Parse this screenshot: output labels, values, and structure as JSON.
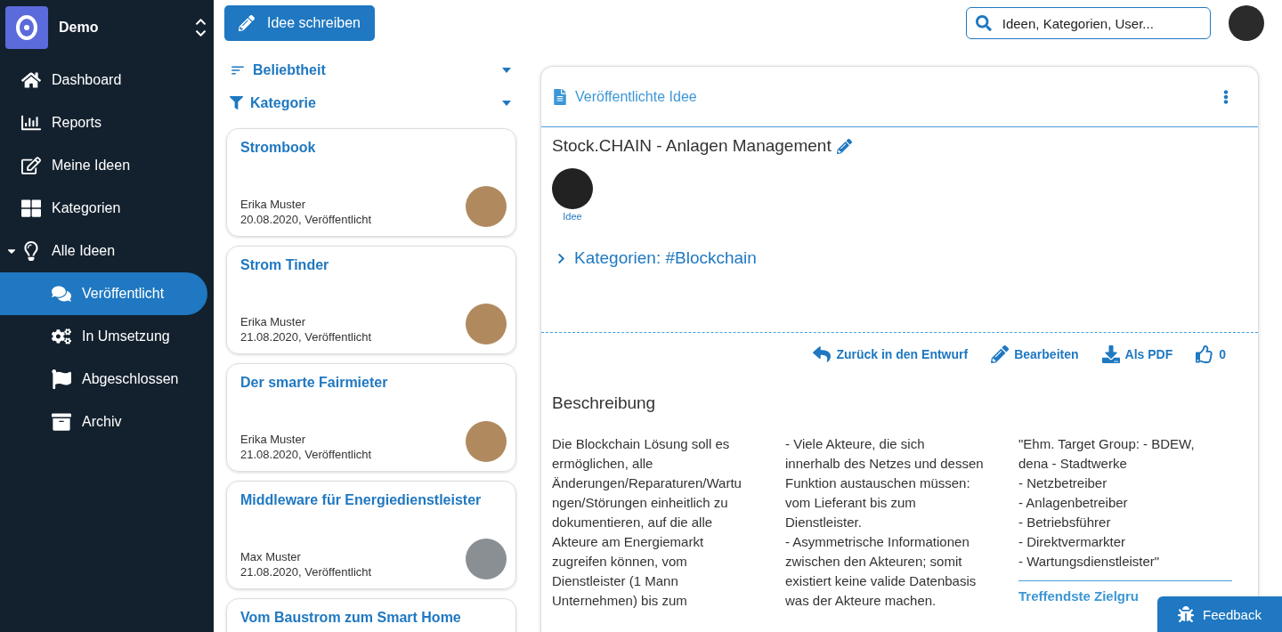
{
  "workspace": {
    "name": "Demo"
  },
  "nav": [
    {
      "label": "Dashboard",
      "selected": false
    },
    {
      "label": "Reports",
      "selected": false
    },
    {
      "label": "Meine Ideen",
      "selected": false
    },
    {
      "label": "Kategorien",
      "selected": false
    },
    {
      "label": "Alle Ideen",
      "selected": false,
      "expanded": true,
      "children": [
        {
          "label": "Veröffentlicht",
          "selected": true
        },
        {
          "label": "In Umsetzung",
          "selected": false
        },
        {
          "label": "Abgeschlossen",
          "selected": false
        },
        {
          "label": "Archiv",
          "selected": false
        }
      ]
    }
  ],
  "toolbar": {
    "write_button": "Idee schreiben",
    "search": {
      "placeholder": "Ideen, Kategorien, User..."
    }
  },
  "filters": [
    {
      "label": "Beliebtheit",
      "kind": "sort"
    },
    {
      "label": "Kategorie",
      "kind": "filter"
    }
  ],
  "ideas": [
    {
      "title": "Strombook",
      "author": "Erika Muster",
      "meta": "20.08.2020, Veröffentlicht"
    },
    {
      "title": "Strom Tinder",
      "author": "Erika Muster",
      "meta": "21.08.2020, Veröffentlicht"
    },
    {
      "title": "Der smarte Fairmieter",
      "author": "Erika Muster",
      "meta": "21.08.2020, Veröffentlicht"
    },
    {
      "title": "Middleware für Energiedienstleister",
      "author": "Max Muster",
      "meta": "21.08.2020, Veröffentlicht"
    },
    {
      "title": "Vom Baustrom zum Smart Home"
    }
  ],
  "detail": {
    "header": "Veröffentlichte Idee",
    "title": "Stock.CHAIN - Anlagen Management",
    "author_role": "Idee",
    "categories": {
      "label": "Kategorien: #Blockchain",
      "expanded": false
    },
    "actions": [
      {
        "label": "Zurück in den Entwurf"
      },
      {
        "label": "Bearbeiten"
      },
      {
        "label": "Als PDF"
      },
      {
        "label": "0"
      }
    ],
    "section_title": "Beschreibung",
    "columns": [
      "Die Blockchain Lösung soll es\nermöglichen, alle\nÄnderungen/Reparaturen/Wartu\nngen/Störungen einheitlich zu\ndokumentieren, auf die alle\nAkteure am Energiemarkt\nzugreifen können, vom\nDienstleister (1 Mann\nUnternehmen) bis zum",
      "- Viele Akteure, die sich\ninnerhalb des Netzes und dessen\nFunktion austauschen müssen:\nvom Lieferant bis zum\nDienstleister.\n- Asymmetrische Informationen\nzwischen den Akteuren; somit\nexistiert keine valide Datenbasis\nwas der Akteure machen.",
      "\"Ehm. Target Group: - BDEW,\ndena - Stadtwerke\n- Netzbetreiber\n- Anlagenbetreiber\n- Betriebsführer\n- Direktvermarkter\n- Wartungsdienstleister\""
    ],
    "target_group_link": "Treffendste Zielgru"
  },
  "feedback_button": "Feedback"
}
